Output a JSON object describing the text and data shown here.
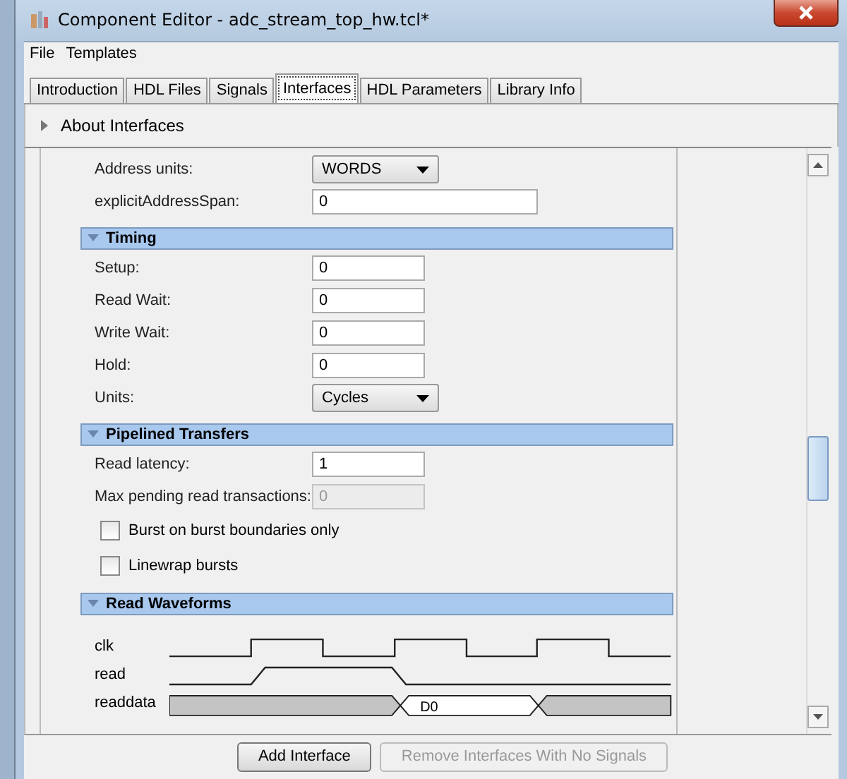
{
  "window": {
    "title": "Component Editor - adc_stream_top_hw.tcl*"
  },
  "menu": [
    "File",
    "Templates"
  ],
  "tabs": [
    {
      "label": "Introduction",
      "selected": false
    },
    {
      "label": "HDL Files",
      "selected": false
    },
    {
      "label": "Signals",
      "selected": false
    },
    {
      "label": "Interfaces",
      "selected": true
    },
    {
      "label": "HDL Parameters",
      "selected": false
    },
    {
      "label": "Library Info",
      "selected": false
    }
  ],
  "about": {
    "label": "About Interfaces",
    "expanded": false
  },
  "top_fields": [
    {
      "kind": "dropdown",
      "label": "Address units:",
      "value": "WORDS"
    },
    {
      "kind": "text",
      "label": "explicitAddressSpan:",
      "value": "0",
      "disabled": false
    }
  ],
  "sections": [
    {
      "title": "Timing",
      "expanded": true,
      "rows": [
        {
          "kind": "text",
          "label": "Setup:",
          "value": "0",
          "disabled": false
        },
        {
          "kind": "text",
          "label": "Read Wait:",
          "value": "0",
          "disabled": false
        },
        {
          "kind": "text",
          "label": "Write Wait:",
          "value": "0",
          "disabled": false
        },
        {
          "kind": "text",
          "label": "Hold:",
          "value": "0",
          "disabled": false
        },
        {
          "kind": "dropdown",
          "label": "Units:",
          "value": "Cycles"
        }
      ]
    },
    {
      "title": "Pipelined Transfers",
      "expanded": true,
      "rows": [
        {
          "kind": "text",
          "label": "Read latency:",
          "value": "1",
          "disabled": false
        },
        {
          "kind": "text",
          "label": "Max pending read transactions:",
          "value": "0",
          "disabled": true
        },
        {
          "kind": "checkbox",
          "label": "Burst on burst boundaries only",
          "checked": false
        },
        {
          "kind": "checkbox",
          "label": "Linewrap bursts",
          "checked": false
        }
      ]
    },
    {
      "title": "Read Waveforms",
      "expanded": true,
      "waveform": {
        "signals": [
          "clk",
          "read",
          "readdata"
        ],
        "data_label": "D0"
      }
    }
  ],
  "buttons": [
    {
      "label": "Add Interface",
      "disabled": false
    },
    {
      "label": "Remove Interfaces With No Signals",
      "disabled": true
    }
  ]
}
